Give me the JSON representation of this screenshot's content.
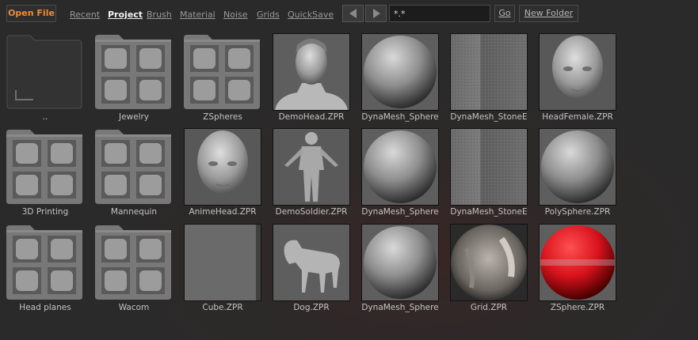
{
  "toolbar": {
    "open_file": "Open File",
    "tabs": [
      "Recent",
      "Project",
      "Brush",
      "Material",
      "Noise",
      "Grids",
      "QuickSave"
    ],
    "active_tab": "Project",
    "filter_value": "*.*",
    "go_label": "Go",
    "new_folder_label": "New Folder"
  },
  "items": [
    {
      "label": "..",
      "kind": "parent-folder-icon"
    },
    {
      "label": "Jewelry",
      "kind": "folder-icon"
    },
    {
      "label": "ZSpheres",
      "kind": "folder-icon"
    },
    {
      "label": "DemoHead.ZPR",
      "kind": "bust-thumbnail"
    },
    {
      "label": "DynaMesh_Sphere",
      "kind": "sphere-thumbnail"
    },
    {
      "label": "DynaMesh_StoneE",
      "kind": "stone-thumbnail"
    },
    {
      "label": "HeadFemale.ZPR",
      "kind": "head-thumbnail"
    },
    {
      "label": "3D Printing",
      "kind": "folder-icon"
    },
    {
      "label": "Mannequin",
      "kind": "folder-icon"
    },
    {
      "label": "AnimeHead.ZPR",
      "kind": "head-thumbnail"
    },
    {
      "label": "DemoSoldier.ZPR",
      "kind": "figure-thumbnail"
    },
    {
      "label": "DynaMesh_Sphere",
      "kind": "sphere-thumbnail"
    },
    {
      "label": "DynaMesh_StoneE",
      "kind": "stone-thumbnail"
    },
    {
      "label": "PolySphere.ZPR",
      "kind": "sphere-thumbnail"
    },
    {
      "label": "Head planes",
      "kind": "folder-icon"
    },
    {
      "label": "Wacom",
      "kind": "folder-icon"
    },
    {
      "label": "Cube.ZPR",
      "kind": "cube-thumbnail"
    },
    {
      "label": "Dog.ZPR",
      "kind": "dog-thumbnail"
    },
    {
      "label": "DynaMesh_Sphere",
      "kind": "sphere-thumbnail"
    },
    {
      "label": "Grid.ZPR",
      "kind": "grid-sphere-thumbnail"
    },
    {
      "label": "ZSphere.ZPR",
      "kind": "zsphere-thumbnail"
    }
  ],
  "colors": {
    "accent": "#f08a33",
    "zsphere_red": "#d8121c"
  }
}
